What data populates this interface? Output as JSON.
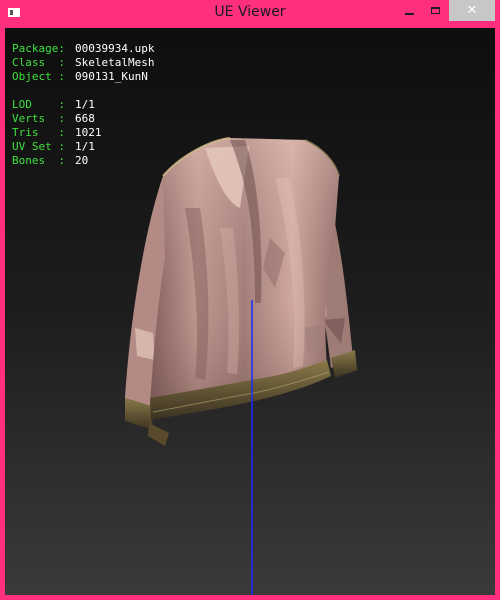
{
  "window": {
    "title": "UE Viewer",
    "close_glyph": "✕",
    "icons": {
      "app": "app-icon",
      "minimize": "minimize-icon",
      "maximize": "maximize-icon",
      "close": "close-icon"
    }
  },
  "colors": {
    "frame": "#ff2f80",
    "info_key": "#3fe03f",
    "info_value": "#ffffff",
    "axis": "#1a2aff"
  },
  "info": {
    "object_rows": [
      {
        "key": "Package:",
        "value": "00039934.upk"
      },
      {
        "key": "Class  :",
        "value": "SkeletalMesh"
      },
      {
        "key": "Object :",
        "value": "090131_KunN"
      }
    ],
    "mesh_rows": [
      {
        "key": "LOD    :",
        "value": "1/1"
      },
      {
        "key": "Verts  :",
        "value": "668"
      },
      {
        "key": "Tris   :",
        "value": "1021"
      },
      {
        "key": "UV Set :",
        "value": "1/1"
      },
      {
        "key": "Bones  :",
        "value": "20"
      }
    ]
  },
  "viewport": {
    "model": "jacket-mesh"
  }
}
